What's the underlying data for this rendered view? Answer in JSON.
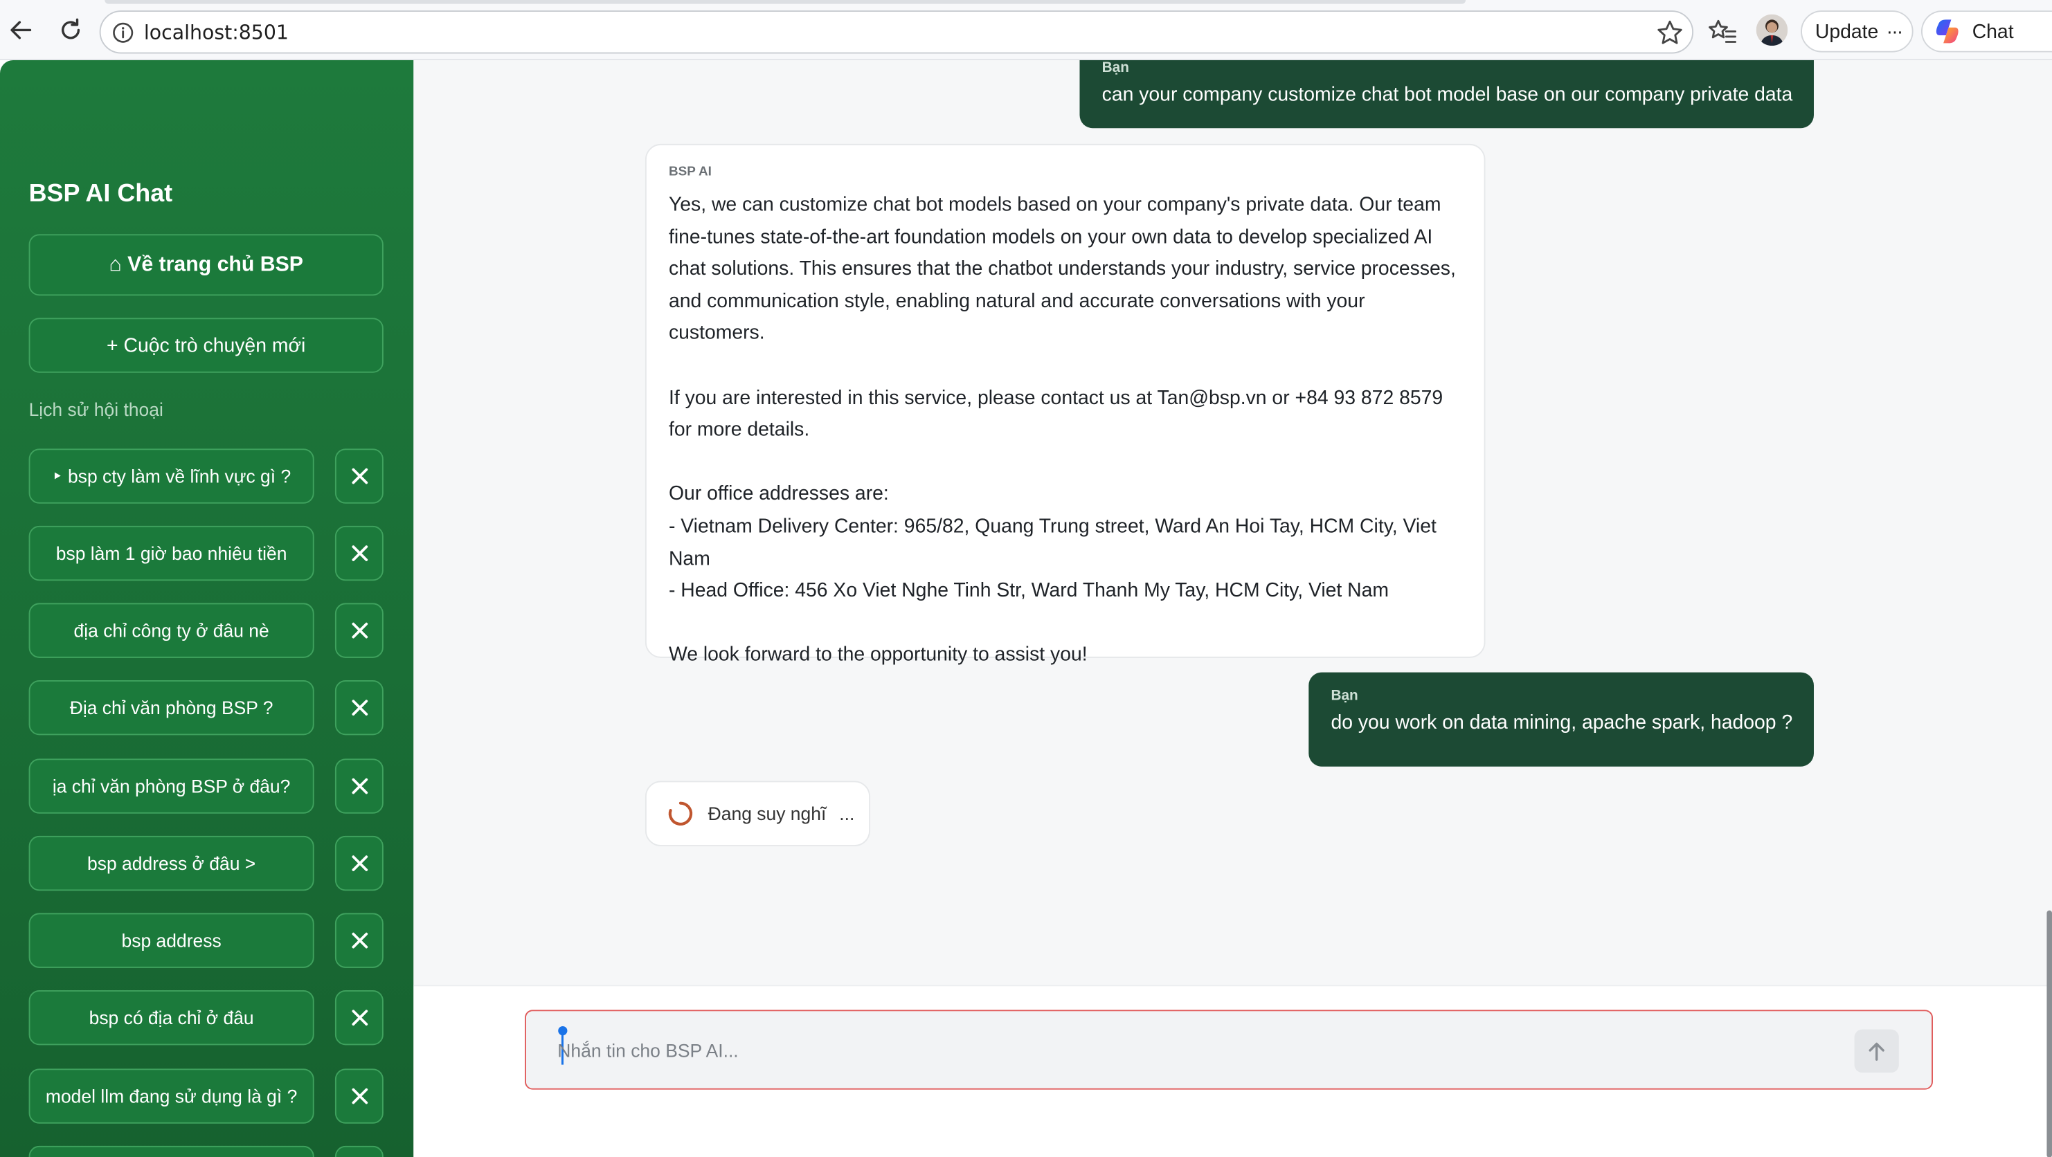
{
  "browser": {
    "url": "localhost:8501",
    "update_label": "Update",
    "update_more": "···",
    "chat_label": "Chat"
  },
  "sidebar": {
    "title": "BSP AI Chat",
    "home_button": "⌂ Về trang chủ BSP",
    "new_chat_button": "+ Cuộc trò chuyện mới",
    "history_label": "Lịch sử hội thoại",
    "history": [
      "‣ bsp cty làm về lĩnh vực gì ?",
      "bsp làm 1 giờ bao nhiêu tiền",
      "địa chỉ công ty ở đâu nè",
      "Địa chỉ văn phòng BSP ?",
      "ịa chỉ văn phòng BSP ở đâu?",
      "bsp address ở đâu >",
      "bsp address",
      "bsp có địa chỉ ở đâu",
      "model llm đang sử dụng là gì ?"
    ]
  },
  "chat": {
    "messages": [
      {
        "who": "Bạn",
        "text": "can your company customize chat bot model base on our company private data"
      },
      {
        "who": "BSP AI",
        "text": "Yes, we can customize chat bot models based on your company's private data. Our team fine-tunes state-of-the-art foundation models on your own data to develop specialized AI chat solutions. This ensures that the chatbot understands your industry, service processes, and communication style, enabling natural and accurate conversations with your customers.\n\nIf you are interested in this service, please contact us at Tan@bsp.vn or +84 93 872 8579 for more details.\n\nOur office addresses are:\n- Vietnam Delivery Center: 965/82, Quang Trung street, Ward An Hoi Tay, HCM City, Viet Nam\n- Head Office: 456 Xo Viet Nghe Tinh Str, Ward Thanh My Tay, HCM City, Viet Nam\n\nWe look forward to the opportunity to assist you!"
      },
      {
        "who": "Bạn",
        "text": "do you work on data mining, apache spark, hadoop ?"
      }
    ],
    "thinking": "Đang suy nghĩ",
    "thinking_dots": "..."
  },
  "composer": {
    "placeholder": "Nhắn tin cho BSP AI..."
  },
  "colors": {
    "sidebar_green": "#1b7a3b",
    "user_bubble": "#1c4a34",
    "spinner": "#c0562f",
    "composer_border": "#e05a5a"
  }
}
